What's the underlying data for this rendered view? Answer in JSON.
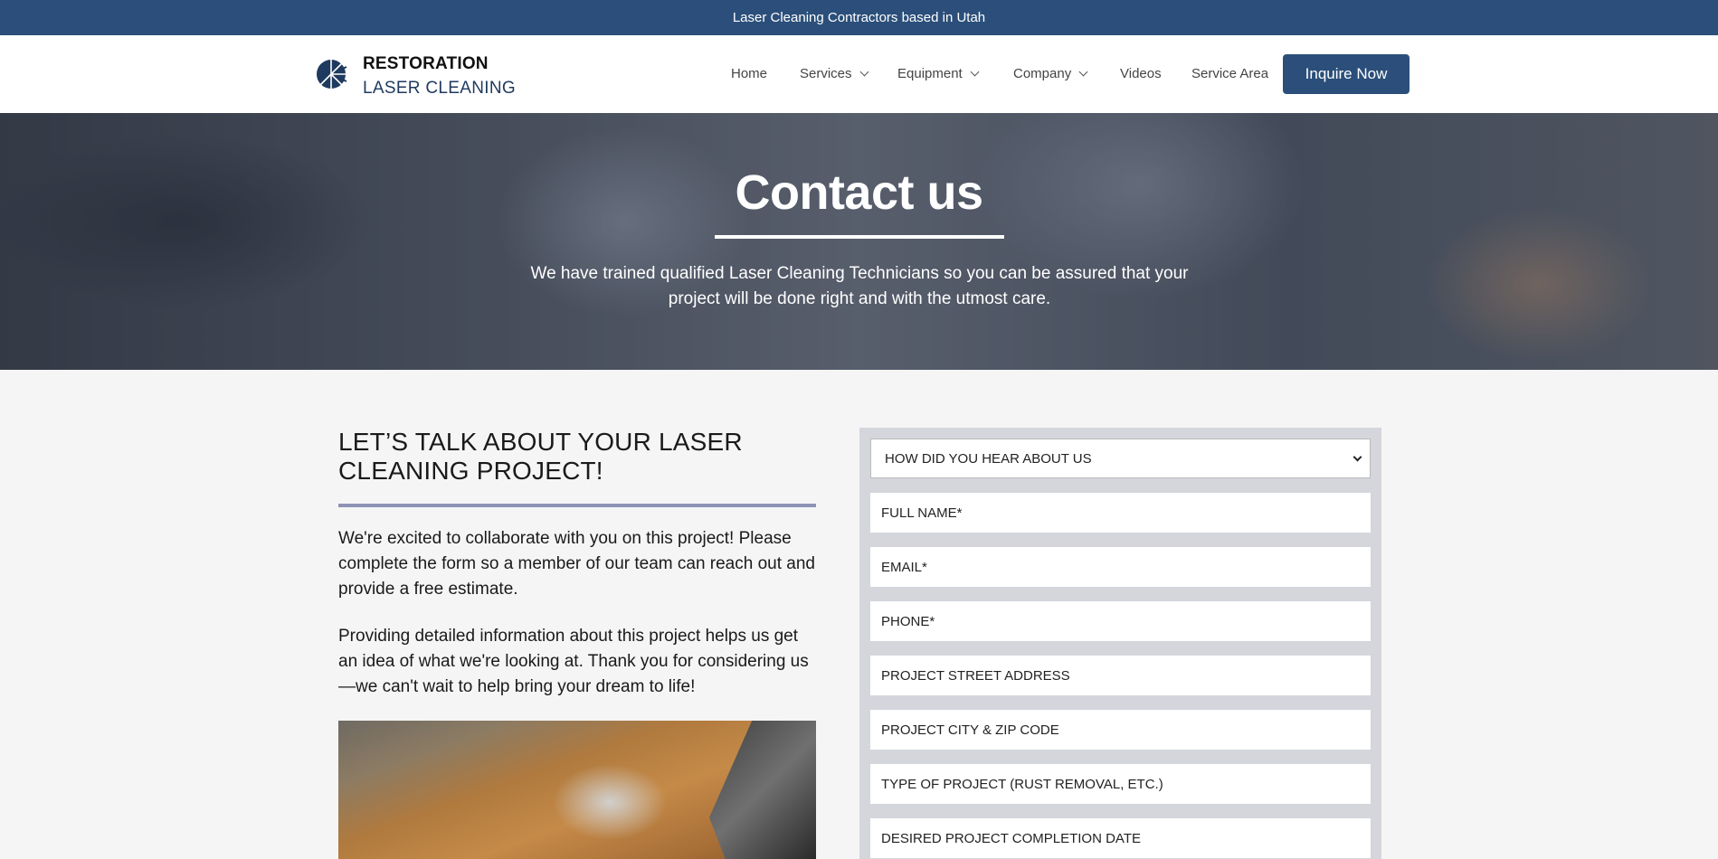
{
  "topbar": {
    "text": "Laser Cleaning Contractors based in Utah"
  },
  "logo": {
    "line1": "RESTORATION",
    "line2": "LASER CLEANING",
    "icon": "starburst-logo-icon"
  },
  "nav": {
    "items": [
      {
        "label": "Home",
        "has_dropdown": false
      },
      {
        "label": "Services",
        "has_dropdown": true
      },
      {
        "label": "Equipment",
        "has_dropdown": true
      },
      {
        "label": "Company",
        "has_dropdown": true
      },
      {
        "label": "Videos",
        "has_dropdown": false
      },
      {
        "label": "Service Area",
        "has_dropdown": false
      }
    ],
    "cta": "Inquire Now"
  },
  "hero": {
    "title": "Contact us",
    "subtitle": "We have trained qualified Laser Cleaning Technicians so you can be assured that your project will be done right and with the utmost care."
  },
  "intro": {
    "title": "LET’S TALK ABOUT YOUR LASER CLEANING PROJECT!",
    "para1": "We're excited to collaborate with you on this project! Please complete the form so a member of our team can reach out and provide a free estimate.",
    "para2": "Providing detailed information about this project helps us get an idea of what we're looking at. Thank you for considering us—we can't wait to help bring your dream to life!"
  },
  "form": {
    "referral_select": "HOW DID YOU HEAR ABOUT US",
    "fields": [
      "FULL NAME*",
      "EMAIL*",
      "PHONE*",
      "PROJECT STREET ADDRESS",
      "PROJECT CITY & ZIP CODE",
      "TYPE OF PROJECT (RUST REMOVAL, ETC.)",
      "DESIRED PROJECT COMPLETION DATE"
    ]
  },
  "colors": {
    "brand_blue": "#2b4f7a",
    "rule_purple": "#8e93b6",
    "form_bg": "#d4d6dc"
  }
}
